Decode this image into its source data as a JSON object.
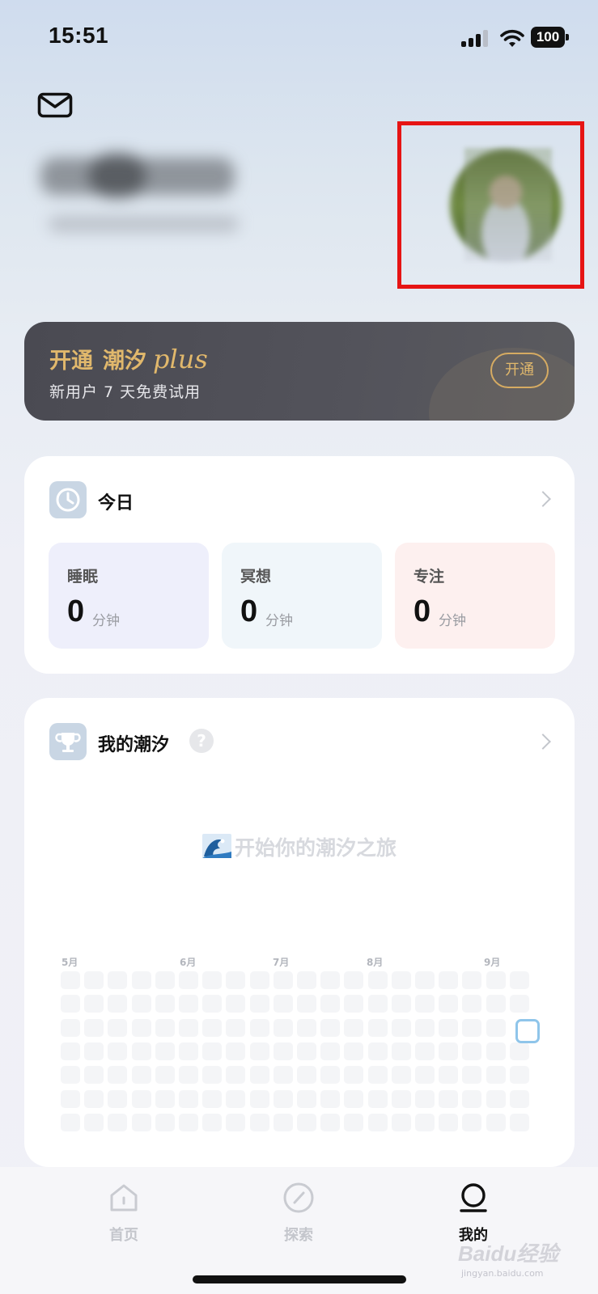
{
  "status_bar": {
    "time": "15:51",
    "battery": "100"
  },
  "plus_banner": {
    "title_prefix": "开通",
    "title_brand": "潮汐",
    "title_script": "plus",
    "subtitle": "新用户 7 天免费试用",
    "button_label": "开通",
    "accent_color": "#e1b86c"
  },
  "today": {
    "title": "今日",
    "stats": [
      {
        "label": "睡眠",
        "value": "0",
        "unit": "分钟",
        "bg": "#eeeffb"
      },
      {
        "label": "冥想",
        "value": "0",
        "unit": "分钟",
        "bg": "#f0f6fa"
      },
      {
        "label": "专注",
        "value": "0",
        "unit": "分钟",
        "bg": "#fdf0ef"
      }
    ]
  },
  "my_tide": {
    "title": "我的潮汐",
    "help_icon": "?",
    "empty_message": "开始你的潮汐之旅",
    "months": [
      "5月",
      "6月",
      "7月",
      "8月",
      "9月"
    ]
  },
  "tab_bar": {
    "tabs": [
      {
        "label": "首页",
        "icon": "home-icon"
      },
      {
        "label": "探索",
        "icon": "compass-icon"
      },
      {
        "label": "我的",
        "icon": "profile-icon"
      }
    ]
  },
  "watermark": {
    "text": "Baidu经验",
    "sub": "jingyan.baidu.com"
  }
}
